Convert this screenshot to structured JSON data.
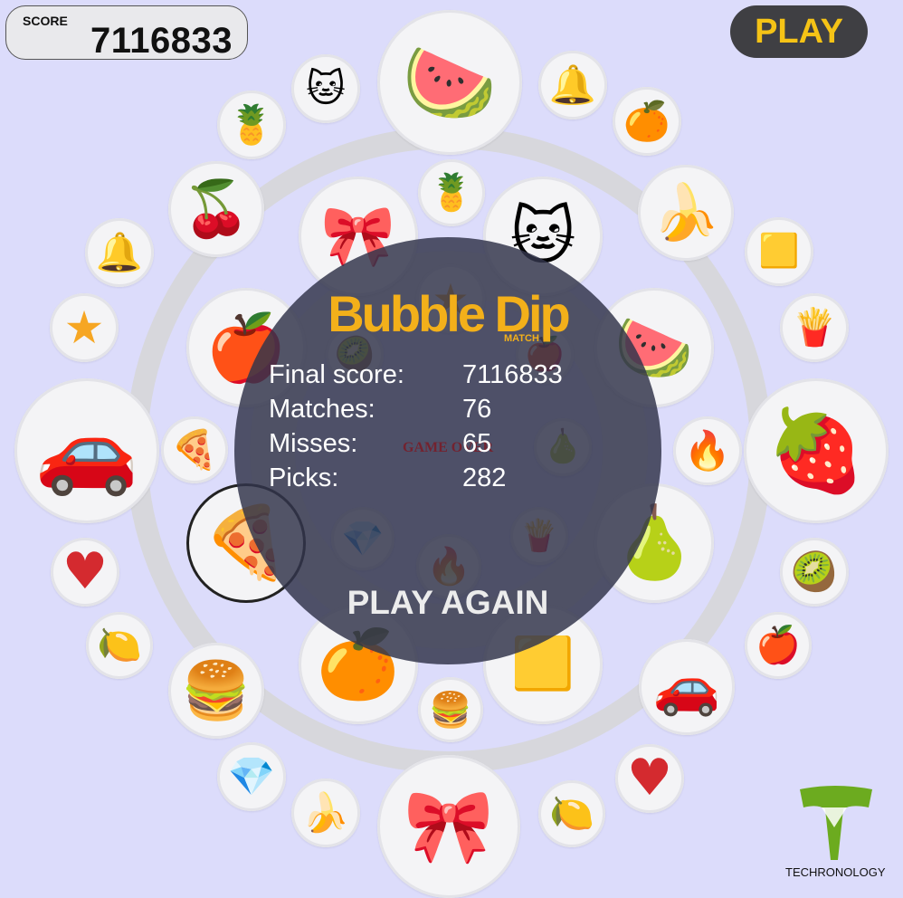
{
  "hud": {
    "score_label": "SCORE",
    "score_value": "7116833",
    "play_label": "PLAY"
  },
  "overlay": {
    "title": "Bubble Dip",
    "subtitle": "MATCH",
    "stats": [
      {
        "label": "Final score:",
        "value": "7116833"
      },
      {
        "label": "Matches:",
        "value": "76"
      },
      {
        "label": "Misses:",
        "value": "65"
      },
      {
        "label": "Picks:",
        "value": "282"
      }
    ],
    "game_over": "GAME OVER",
    "play_again": "PLAY AGAIN"
  },
  "brand": {
    "name": "TECHRONOLOGY"
  },
  "colors": {
    "background": "#dcdcfb",
    "accent": "#f5c316",
    "overlay": "#32344b",
    "logo": "#f3b01a",
    "brand_green": "#6cab1f"
  },
  "items": [
    {
      "icon": "watermelon-icon",
      "glyph": "🍉"
    },
    {
      "icon": "cat-icon",
      "glyph": "🐱"
    },
    {
      "icon": "bell-icon",
      "glyph": "🔔"
    },
    {
      "icon": "pineapple-icon",
      "glyph": "🍍"
    },
    {
      "icon": "orange-icon",
      "glyph": "🍊"
    },
    {
      "icon": "cherries-icon",
      "glyph": "🍒"
    },
    {
      "icon": "candy-cane-icon",
      "glyph": "🎀"
    },
    {
      "icon": "pineapple-icon",
      "glyph": "🍍"
    },
    {
      "icon": "cat-icon",
      "glyph": "🐱"
    },
    {
      "icon": "banana-icon",
      "glyph": "🍌"
    },
    {
      "icon": "bell-icon",
      "glyph": "🔔"
    },
    {
      "icon": "gold-bars-icon",
      "glyph": "🟨"
    },
    {
      "icon": "star-icon",
      "glyph": "★"
    },
    {
      "icon": "apple-icon",
      "glyph": "🍎"
    },
    {
      "icon": "watermelon-icon",
      "glyph": "🍉"
    },
    {
      "icon": "fries-icon",
      "glyph": "🍟"
    },
    {
      "icon": "car-icon",
      "glyph": "🚗"
    },
    {
      "icon": "pizza-icon",
      "glyph": "🍕"
    },
    {
      "icon": "fire-icon",
      "glyph": "🔥"
    },
    {
      "icon": "strawberry-icon",
      "glyph": "🍓"
    },
    {
      "icon": "pizza-icon",
      "glyph": "🍕"
    },
    {
      "icon": "pear-icon",
      "glyph": "🍐"
    },
    {
      "icon": "heart-icon",
      "glyph": "♥"
    },
    {
      "icon": "kiwi-icon",
      "glyph": "🥝"
    },
    {
      "icon": "lemon-icon",
      "glyph": "🍋"
    },
    {
      "icon": "orange-icon",
      "glyph": "🍊"
    },
    {
      "icon": "gold-bars-icon",
      "glyph": "🟨"
    },
    {
      "icon": "apple-icon",
      "glyph": "🍎"
    },
    {
      "icon": "burger-icon",
      "glyph": "🍔"
    },
    {
      "icon": "burger-icon",
      "glyph": "🍔"
    },
    {
      "icon": "car-icon",
      "glyph": "🚗"
    },
    {
      "icon": "diamond-icon",
      "glyph": "💎"
    },
    {
      "icon": "heart-icon",
      "glyph": "♥"
    },
    {
      "icon": "banana-icon",
      "glyph": "🍌"
    },
    {
      "icon": "candy-cane-icon",
      "glyph": "🎀"
    },
    {
      "icon": "lemon-icon",
      "glyph": "🍋"
    },
    {
      "icon": "star-icon",
      "glyph": "★"
    },
    {
      "icon": "kiwi-icon",
      "glyph": "🥝"
    },
    {
      "icon": "apple-icon",
      "glyph": "🍎"
    },
    {
      "icon": "pear-icon",
      "glyph": "🍐"
    },
    {
      "icon": "diamond-icon",
      "glyph": "💎"
    },
    {
      "icon": "fire-icon",
      "glyph": "🔥"
    },
    {
      "icon": "fries-icon",
      "glyph": "🍟"
    }
  ]
}
